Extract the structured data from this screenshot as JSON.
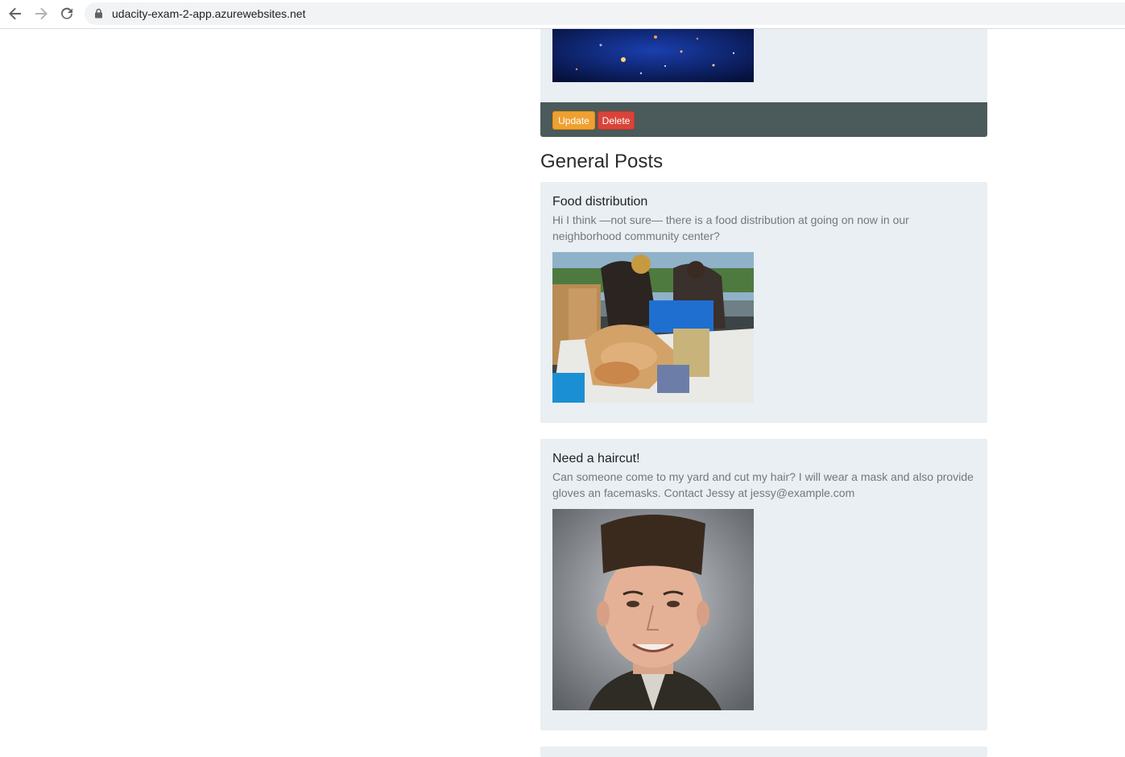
{
  "browser": {
    "url": "udacity-exam-2-app.azurewebsites.net"
  },
  "top_post": {
    "buttons": {
      "update": "Update",
      "delete": "Delete"
    }
  },
  "section": {
    "title": "General Posts"
  },
  "posts": [
    {
      "title": "Food distribution",
      "body": "Hi I think —not sure— there is a food distribution at going on now in our neighborhood community center?",
      "image": "food-distribution-photo"
    },
    {
      "title": "Need a haircut!",
      "body": "Can someone come to my yard and cut my hair? I will wear a mask and also provide gloves an facemasks. Contact Jessy at jessy@example.com",
      "image": "flat-top-haircut-portrait"
    }
  ],
  "colors": {
    "card_bg": "#e9eff3",
    "footer_bg": "#4b5a5a",
    "update_btn": "#f0a030",
    "delete_btn": "#d9443a"
  }
}
